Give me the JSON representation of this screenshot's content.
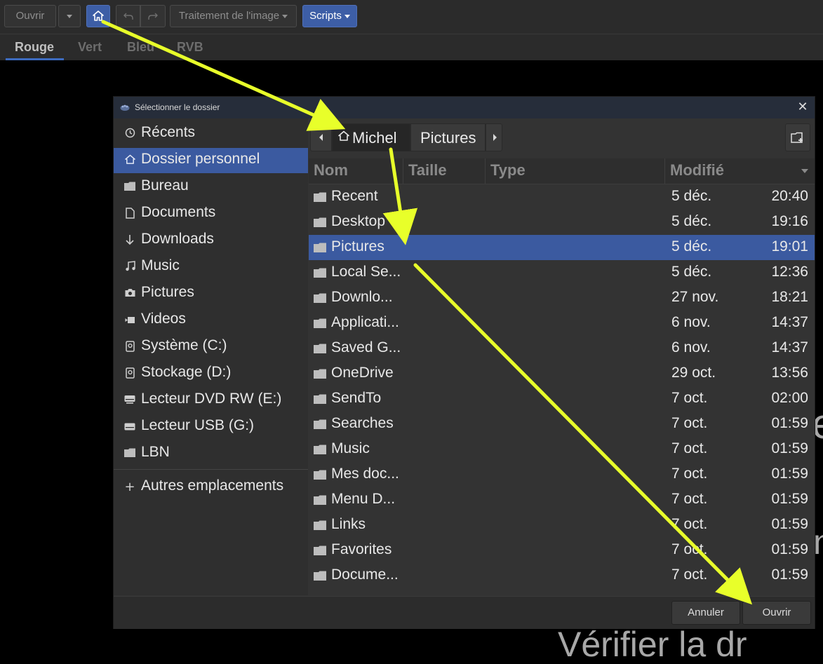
{
  "toolbar": {
    "open_label": "Ouvrir",
    "image_processing_label": "Traitement de l'image",
    "scripts_label": "Scripts"
  },
  "tabs": [
    {
      "label": "Rouge",
      "active": true
    },
    {
      "label": "Vert",
      "active": false
    },
    {
      "label": "Bleu",
      "active": false
    },
    {
      "label": "RVB",
      "active": false
    }
  ],
  "background_text": {
    "fragment_1": "e",
    "fragment_2": "n",
    "fragment_3": "Vérifier la dr"
  },
  "dialog": {
    "title": "Sélectionner le dossier",
    "sidebar": {
      "items": [
        {
          "label": "Récents",
          "icon": "clock-icon"
        },
        {
          "label": "Dossier personnel",
          "icon": "home-icon",
          "selected": true
        },
        {
          "label": "Bureau",
          "icon": "folder-icon"
        },
        {
          "label": "Documents",
          "icon": "document-icon"
        },
        {
          "label": "Downloads",
          "icon": "download-icon"
        },
        {
          "label": "Music",
          "icon": "music-icon"
        },
        {
          "label": "Pictures",
          "icon": "camera-icon"
        },
        {
          "label": "Videos",
          "icon": "video-icon"
        },
        {
          "label": "Système (C:)",
          "icon": "drive-icon"
        },
        {
          "label": "Stockage (D:)",
          "icon": "drive-icon"
        },
        {
          "label": "Lecteur DVD RW (E:)",
          "icon": "optical-drive-icon"
        },
        {
          "label": "Lecteur USB (G:)",
          "icon": "usb-drive-icon"
        },
        {
          "label": "LBN",
          "icon": "folder-icon"
        }
      ],
      "other_locations": "Autres emplacements"
    },
    "path": {
      "segments": [
        "Michel",
        "Pictures"
      ]
    },
    "columns": {
      "name": "Nom",
      "size": "Taille",
      "type": "Type",
      "modified": "Modifié"
    },
    "files": [
      {
        "name": "Recent",
        "date": "5 déc.",
        "time": "20:40",
        "selected": false
      },
      {
        "name": "Desktop",
        "date": "5 déc.",
        "time": "19:16",
        "selected": false
      },
      {
        "name": "Pictures",
        "date": "5 déc.",
        "time": "19:01",
        "selected": true
      },
      {
        "name": "Local Se...",
        "date": "5 déc.",
        "time": "12:36",
        "selected": false
      },
      {
        "name": "Downlo...",
        "date": "27 nov.",
        "time": "18:21",
        "selected": false
      },
      {
        "name": "Applicati...",
        "date": "6 nov.",
        "time": "14:37",
        "selected": false
      },
      {
        "name": "Saved G...",
        "date": "6 nov.",
        "time": "14:37",
        "selected": false
      },
      {
        "name": "OneDrive",
        "date": "29 oct.",
        "time": "13:56",
        "selected": false
      },
      {
        "name": "SendTo",
        "date": "7 oct.",
        "time": "02:00",
        "selected": false
      },
      {
        "name": "Searches",
        "date": "7 oct.",
        "time": "01:59",
        "selected": false
      },
      {
        "name": "Music",
        "date": "7 oct.",
        "time": "01:59",
        "selected": false
      },
      {
        "name": "Mes doc...",
        "date": "7 oct.",
        "time": "01:59",
        "selected": false
      },
      {
        "name": "Menu D...",
        "date": "7 oct.",
        "time": "01:59",
        "selected": false
      },
      {
        "name": "Links",
        "date": "7 oct.",
        "time": "01:59",
        "selected": false
      },
      {
        "name": "Favorites",
        "date": "7 oct.",
        "time": "01:59",
        "selected": false
      },
      {
        "name": "Docume...",
        "date": "7 oct.",
        "time": "01:59",
        "selected": false
      }
    ],
    "buttons": {
      "cancel": "Annuler",
      "open": "Ouvrir"
    }
  },
  "colors": {
    "accent_blue": "#3b5aa0",
    "annotation_arrow": "#e8ff2a"
  }
}
